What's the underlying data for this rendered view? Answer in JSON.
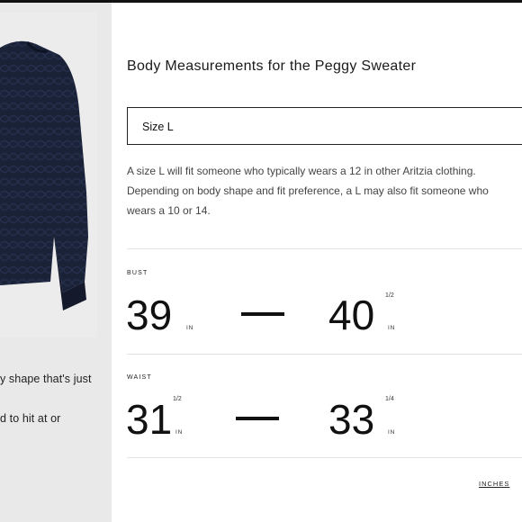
{
  "product": {
    "description_lines": [
      "y shape that's just",
      "d to hit at or"
    ]
  },
  "modal": {
    "title": "Body Measurements for the Peggy Sweater",
    "size_select": {
      "value": "Size L"
    },
    "description": [
      "A size L will fit someone who typically wears a 12 in other Aritzia clothing.",
      "Depending on body shape and fit preference, a L may also fit someone who",
      "wears a 10 or 14."
    ],
    "measurements": [
      {
        "label": "BUST",
        "min": {
          "whole": "39",
          "fraction": "",
          "unit": "IN"
        },
        "max": {
          "whole": "40",
          "fraction": "1/2",
          "unit": "IN"
        }
      },
      {
        "label": "WAIST",
        "min": {
          "whole": "31",
          "fraction": "1/2",
          "unit": "IN"
        },
        "max": {
          "whole": "33",
          "fraction": "1/4",
          "unit": "IN"
        }
      }
    ],
    "units_link": "INCHES"
  }
}
